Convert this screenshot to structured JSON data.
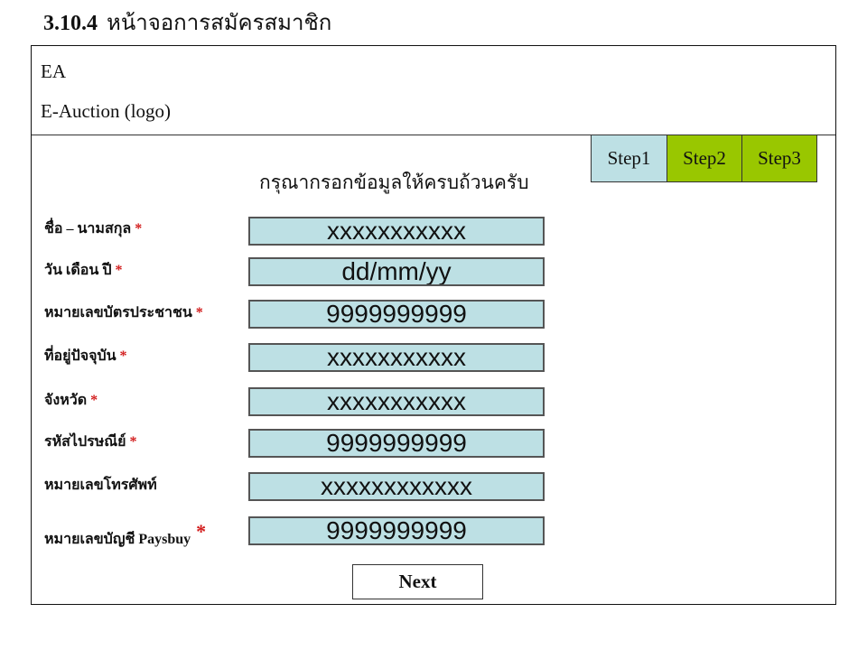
{
  "document": {
    "section_number": "3.10.4",
    "section_title": "หน้าจอการสมัครสมาชิก"
  },
  "header": {
    "brand": "EA",
    "logo_text": "E-Auction (logo)"
  },
  "steps": [
    {
      "label": "Step1",
      "state": "current",
      "color": "#bde0e4"
    },
    {
      "label": "Step2",
      "state": "upcoming",
      "color": "#99c700"
    },
    {
      "label": "Step3",
      "state": "upcoming",
      "color": "#99c700"
    }
  ],
  "form": {
    "instruction": "กรุณากรอกข้อมูลให้ครบถ้วนครับ",
    "required_marker": "*",
    "required_color": "#d21b1b",
    "field_color": "#bde0e4",
    "fields": [
      {
        "label": "ชื่อ – นามสกุล",
        "required": true,
        "value": "xxxxxxxxxxx"
      },
      {
        "label": "วัน เดือน ปี",
        "required": true,
        "value": "dd/mm/yy"
      },
      {
        "label": "หมายเลขบัตรประชาชน",
        "required": true,
        "value": "9999999999"
      },
      {
        "label": "ที่อยู่ปัจจุบัน",
        "required": true,
        "value": "xxxxxxxxxxx"
      },
      {
        "label": "จังหวัด",
        "required": true,
        "value": "xxxxxxxxxxx"
      },
      {
        "label": "รหัสไปรษณีย์",
        "required": true,
        "value": "9999999999"
      },
      {
        "label": "หมายเลขโทรศัพท์",
        "required": false,
        "value": "xxxxxxxxxxxx"
      },
      {
        "label": "หมายเลขบัญชี",
        "label_suffix": "Paysbuy",
        "required": true,
        "value": "9999999999"
      }
    ],
    "next_label": "Next"
  }
}
